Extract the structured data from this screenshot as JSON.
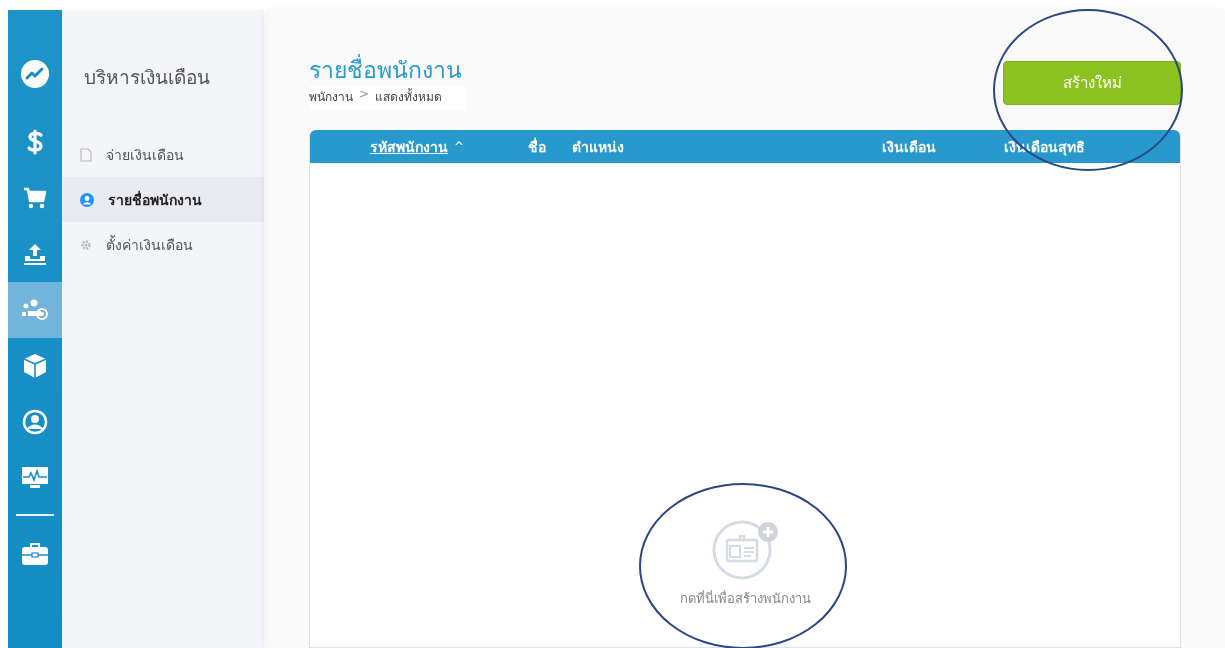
{
  "rail": {
    "items": [
      {
        "selected": false
      },
      {
        "selected": false
      },
      {
        "selected": false
      },
      {
        "selected": true
      },
      {
        "selected": false
      },
      {
        "selected": false
      },
      {
        "selected": false
      },
      {
        "selected": false
      }
    ]
  },
  "sidebar": {
    "title": "บริหารเงินเดือน",
    "items": [
      {
        "label": "จ่ายเงินเดือน",
        "selected": false
      },
      {
        "label": "รายชื่อพนักงาน",
        "selected": true
      },
      {
        "label": "ตั้งค่าเงินเดือน",
        "selected": false
      }
    ]
  },
  "page": {
    "title": "รายชื่อพนักงาน",
    "breadcrumb": [
      "พนักงาน",
      "แสดงทั้งหมด"
    ],
    "breadcrumb_separator": ">",
    "create_button": "สร้างใหม่"
  },
  "table": {
    "columns": [
      {
        "label": "รหัสพนักงาน",
        "sorted": true,
        "sort_caret": "^"
      },
      {
        "label": "ชื่อ",
        "sorted": false
      },
      {
        "label": "ตำแหน่ง",
        "sorted": false
      },
      {
        "label": "เงินเดือน",
        "sorted": false
      },
      {
        "label": "เงินเดือนสุทธิ",
        "sorted": false
      }
    ],
    "empty_state": {
      "text": "กดที่นี่เพื่อสร้างพนักงาน"
    }
  }
}
